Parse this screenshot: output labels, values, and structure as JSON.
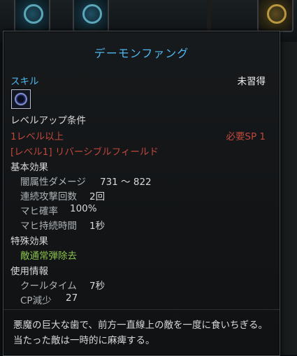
{
  "tooltip": {
    "title": "デーモンファング",
    "skill_label": "スキル",
    "status": "未習得",
    "skill_icon": "dark-orb-icon",
    "levelup_heading": "レベルアップ条件",
    "level_req": "1レベル以上",
    "sp_req": "必要SP 1",
    "prereq_skill": "[レベル1] リバーシブルフィールド",
    "basic_heading": "基本効果",
    "basic_effects": [
      {
        "label": "闇属性ダメージ",
        "value": "731 ～ 822"
      },
      {
        "label": "連続攻撃回数",
        "value": "2回"
      },
      {
        "label": "マヒ確率",
        "value": "100%"
      },
      {
        "label": "マヒ持続時間",
        "value": "1秒"
      }
    ],
    "special_heading": "特殊効果",
    "special_effect": "敵通常弾除去",
    "usage_heading": "使用情報",
    "usage": [
      {
        "label": "クールタイム",
        "value": "7秒"
      },
      {
        "label": "CP減少",
        "value": "27"
      }
    ],
    "description": "悪魔の巨大な歯で、前方一直線上の敵を一度に食いちぎる。当たった敵は一時的に麻痺する。"
  },
  "colors": {
    "title_blue": "#4fb7f0",
    "requirement_red": "#c0473c",
    "special_green": "#8bc34a",
    "label_gray": "#aeb3b6"
  }
}
